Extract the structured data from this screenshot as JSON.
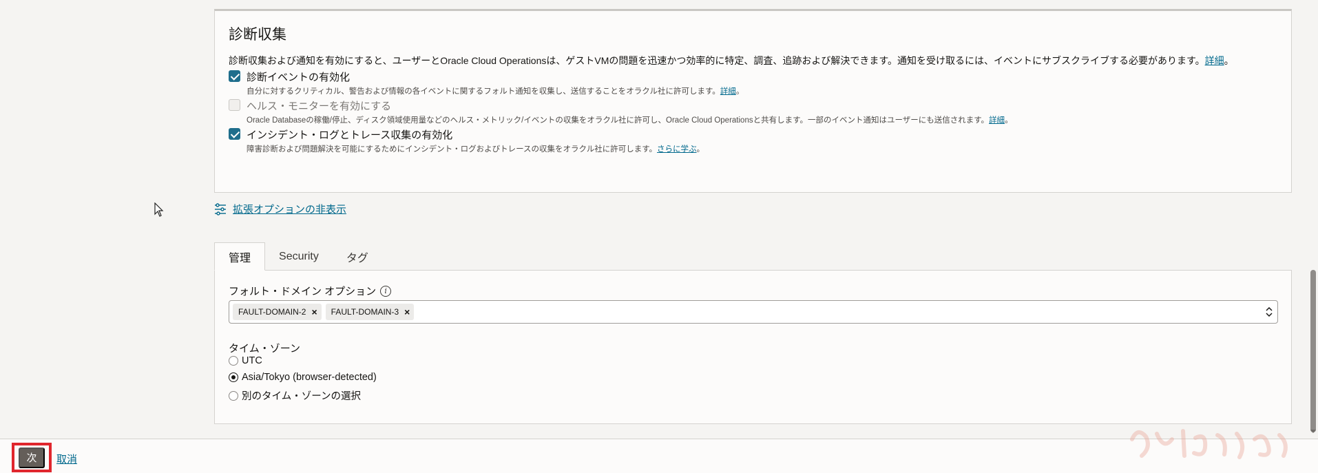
{
  "diagnostics": {
    "title": "診断収集",
    "description": "診断収集および通知を有効にすると、ユーザーとOracle Cloud Operationsは、ゲストVMの問題を迅速かつ効率的に特定、調査、追跡および解決できます。通知を受け取るには、イベントにサブスクライブする必要があります。",
    "description_link": "詳細",
    "description_end": "。",
    "options": [
      {
        "label": "診断イベントの有効化",
        "checked": true,
        "disabled": false,
        "help": "自分に対するクリティカル、警告および情報の各イベントに関するフォルト通知を収集し、送信することをオラクル社に許可します。",
        "help_link": "詳細",
        "help_end": "。"
      },
      {
        "label": "ヘルス・モニターを有効にする",
        "checked": false,
        "disabled": true,
        "help": "Oracle Databaseの稼働/停止、ディスク領域使用量などのヘルス・メトリック/イベントの収集をオラクル社に許可し、Oracle Cloud Operationsと共有します。一部のイベント通知はユーザーにも送信されます。",
        "help_link": "詳細",
        "help_end": "。"
      },
      {
        "label": "インシデント・ログとトレース収集の有効化",
        "checked": true,
        "disabled": false,
        "help": "障害診断および問題解決を可能にするためにインシデント・ログおよびトレースの収集をオラクル社に許可します。",
        "help_link": "さらに学ぶ",
        "help_end": "。"
      }
    ]
  },
  "advanced_toggle": {
    "label": "拡張オプションの非表示",
    "icon": "sliders-icon"
  },
  "tabs": [
    {
      "label": "管理",
      "active": true
    },
    {
      "label": "Security",
      "active": false
    },
    {
      "label": "タグ",
      "active": false
    }
  ],
  "management": {
    "fault_domain": {
      "label": "フォルト・ドメイン オプション",
      "selected": [
        "FAULT-DOMAIN-2",
        "FAULT-DOMAIN-3"
      ],
      "remove_glyph": "×"
    },
    "timezone": {
      "label": "タイム・ゾーン",
      "options": [
        {
          "label": "UTC",
          "selected": false
        },
        {
          "label": "Asia/Tokyo (browser-detected)",
          "selected": true
        },
        {
          "label": "別のタイム・ゾーンの選択",
          "selected": false
        }
      ]
    }
  },
  "footer": {
    "next_label": "次",
    "cancel_label": "取消",
    "highlight_color": "#e0262d"
  },
  "colors": {
    "accent": "#1f6e8c",
    "link": "#00688c",
    "primary_button": "#645e59"
  }
}
